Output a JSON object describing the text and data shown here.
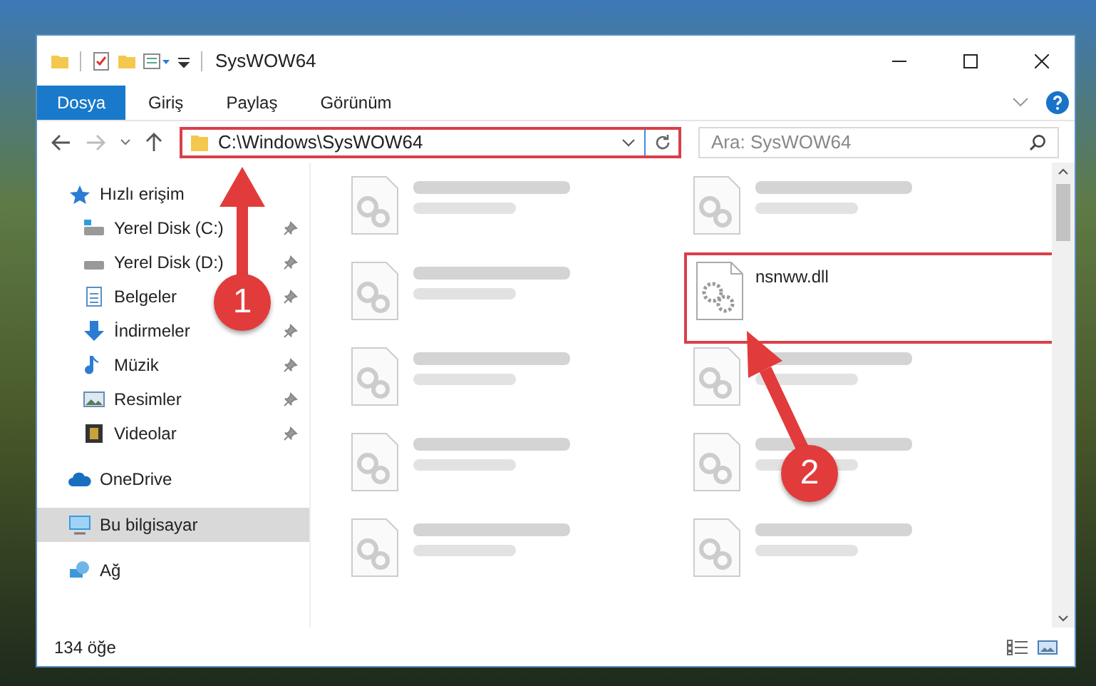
{
  "window": {
    "title": "SysWOW64"
  },
  "ribbon_tabs": [
    {
      "label": "Dosya",
      "selected": true
    },
    {
      "label": "Giriş",
      "selected": false
    },
    {
      "label": "Paylaş",
      "selected": false
    },
    {
      "label": "Görünüm",
      "selected": false
    }
  ],
  "address_bar": {
    "path": "C:\\Windows\\SysWOW64",
    "highlighted": true
  },
  "search": {
    "placeholder": "Ara: SysWOW64"
  },
  "sidebar": {
    "items": [
      {
        "label": "Hızlı erişim",
        "kind": "quick",
        "selected": false,
        "children": [
          {
            "label": "Yerel Disk (C:)",
            "kind": "drive-c",
            "pinned": true,
            "selected": false
          },
          {
            "label": "Yerel Disk (D:)",
            "kind": "drive",
            "pinned": true,
            "selected": false
          },
          {
            "label": "Belgeler",
            "kind": "documents",
            "pinned": true,
            "selected": false
          },
          {
            "label": "İndirmeler",
            "kind": "downloads",
            "pinned": true,
            "selected": false
          },
          {
            "label": "Müzik",
            "kind": "music",
            "pinned": true,
            "selected": false
          },
          {
            "label": "Resimler",
            "kind": "pictures",
            "pinned": true,
            "selected": false
          },
          {
            "label": "Videolar",
            "kind": "videos",
            "pinned": true,
            "selected": false
          }
        ]
      },
      {
        "label": "OneDrive",
        "kind": "cloud",
        "selected": false
      },
      {
        "label": "Bu bilgisayar",
        "kind": "computer",
        "selected": true
      },
      {
        "label": "Ağ",
        "kind": "network",
        "selected": false
      }
    ]
  },
  "files": [
    {
      "kind": "blurred",
      "highlighted": false
    },
    {
      "kind": "blurred",
      "highlighted": false
    },
    {
      "kind": "blurred",
      "highlighted": false
    },
    {
      "kind": "file",
      "name": "nsnww.dll",
      "highlighted": true
    },
    {
      "kind": "blurred",
      "highlighted": false
    },
    {
      "kind": "blurred",
      "highlighted": false
    },
    {
      "kind": "blurred",
      "highlighted": false
    },
    {
      "kind": "blurred",
      "highlighted": false
    },
    {
      "kind": "blurred",
      "highlighted": false
    },
    {
      "kind": "blurred",
      "highlighted": false
    }
  ],
  "status_bar": {
    "item_count": "134 öğe"
  },
  "annotations": [
    {
      "number": "1"
    },
    {
      "number": "2"
    }
  ]
}
